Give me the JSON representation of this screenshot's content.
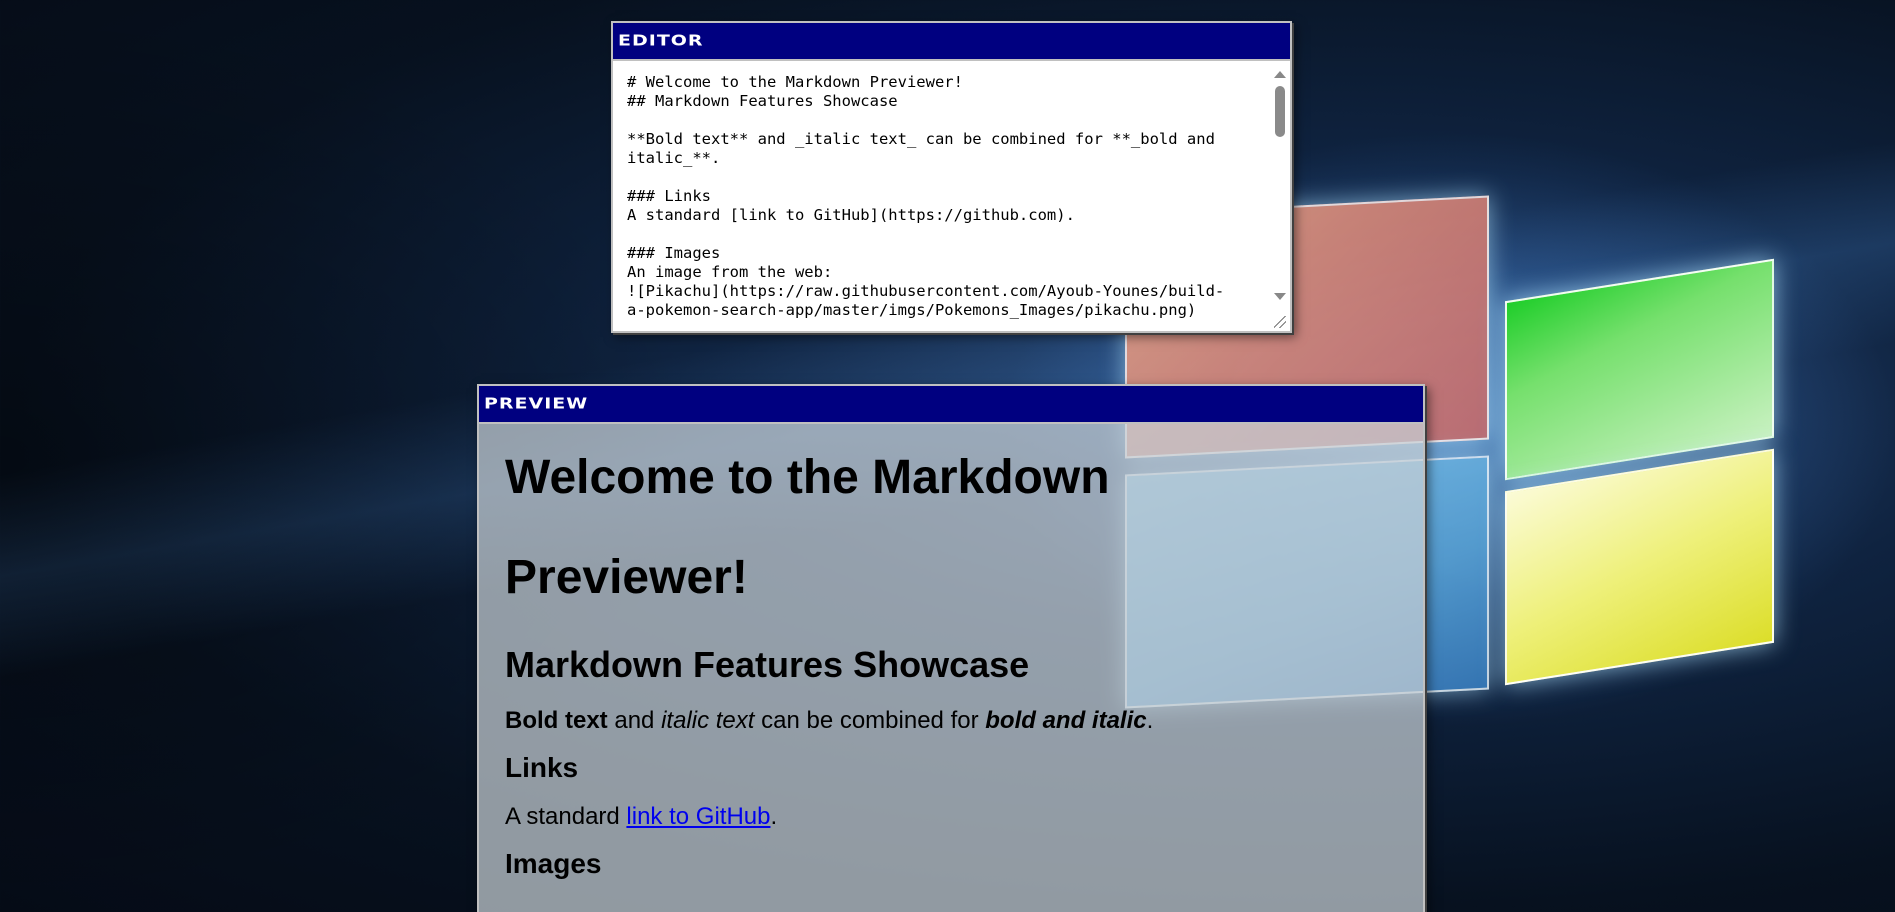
{
  "editor": {
    "title": "Editor",
    "content": "# Welcome to the Markdown Previewer!\n## Markdown Features Showcase\n\n**Bold text** and _italic text_ can be combined for **_bold and italic_**.\n\n### Links\nA standard [link to GitHub](https://github.com).\n\n### Images\nAn image from the web:\n![Pikachu](https://raw.githubusercontent.com/Ayoub-Younes/build-a-pokemon-search-app/master/imgs/Pokemons_Images/pikachu.png)"
  },
  "preview": {
    "title": "Preview",
    "h1": "Welcome to the Markdown Previewer!",
    "h2": "Markdown Features Showcase",
    "paragraph": {
      "bold": "Bold text",
      "and": " and ",
      "italic": "italic text",
      "combined": " can be combined for ",
      "bold_italic": "bold and italic",
      "end": "."
    },
    "links_heading": "Links",
    "link_paragraph": {
      "before": "A standard ",
      "link_text": "link to GitHub",
      "after": "."
    },
    "images_heading": "Images"
  },
  "colors": {
    "titlebar": "#000080",
    "link": "#0000ee"
  }
}
